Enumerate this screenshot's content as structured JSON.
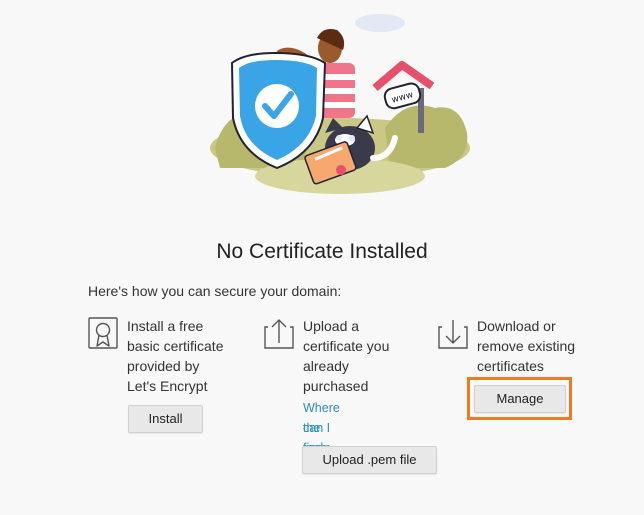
{
  "heading": "No Certificate Installed",
  "intro": "Here's how you can secure your domain:",
  "options": [
    {
      "icon": "certificate-ribbon-icon",
      "lines": [
        "Install a free",
        "basic certificate",
        "provided by",
        "Let's Encrypt"
      ],
      "button": "Install"
    },
    {
      "icon": "upload-arrow-icon",
      "lines": [
        "Upload a",
        "certificate you",
        "already",
        "purchased"
      ],
      "link_lines": [
        "Where can I find",
        "the .pem file?"
      ],
      "button": "Upload .pem file"
    },
    {
      "icon": "download-arrow-icon",
      "lines": [
        "Download or",
        "remove existing",
        "certificates"
      ],
      "button": "Manage"
    }
  ],
  "illustration": {
    "description_icons": [
      "shield-check-icon",
      "www-sign-icon",
      "certificate-icon"
    ],
    "sign_text": "www"
  },
  "colors": {
    "link": "#2a8fc4",
    "highlight": "#f07a22",
    "shield": "#3aa5e6",
    "button_bg": "#e8e8e8"
  }
}
